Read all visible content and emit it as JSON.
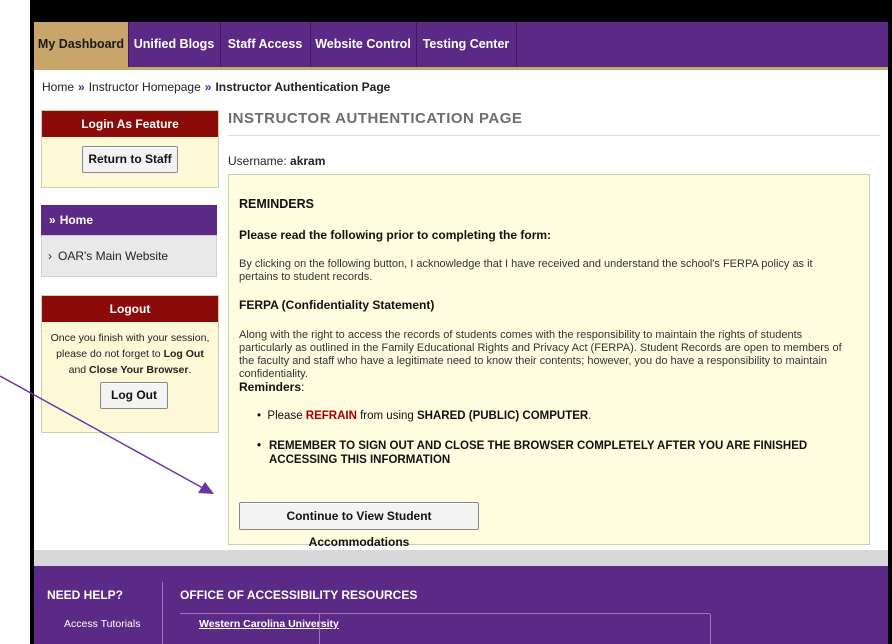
{
  "nav": {
    "tabs": [
      "My Dashboard",
      "Unified Blogs",
      "Staff Access",
      "Website Control",
      "Testing Center"
    ],
    "active_tab": "My Dashboard"
  },
  "breadcrumb": {
    "home": "Home",
    "separator": "»",
    "instructor": "Instructor Homepage",
    "current": "Instructor Authentication Page"
  },
  "sidebar": {
    "login_feature": {
      "title": "Login As Feature",
      "button": "Return to Staff"
    },
    "home_label": "Home",
    "home_icon": "chevron-double-down-icon",
    "links": [
      {
        "label": "OAR's Main Website",
        "icon": "chevron-right-icon"
      }
    ],
    "logout": {
      "title": "Logout",
      "text_1": "Once you finish with your session,",
      "text_2a": "please do not forget to ",
      "text_2b": "Log Out",
      "text_3a": "and ",
      "text_3b": "Close Your Browser",
      "text_3c": ".",
      "button": "Log Out"
    }
  },
  "main": {
    "title": "INSTRUCTOR AUTHENTICATION PAGE",
    "username_label": "Username: ",
    "username_value": "akram",
    "reminders": {
      "heading": "REMINDERS",
      "read_prompt": "Please read the following prior to completing the form:",
      "acknowledge": "By clicking on the following button, I acknowledge that I have received and understand the school's FERPA policy as it pertains to student records.",
      "ferpa_heading": "FERPA (Confidentiality Statement)",
      "ferpa_text": "Along with the right to access the records of students comes with the responsibility to maintain the rights of students particularly as outlined in the Family Educational Rights and Privacy Act (FERPA). Student Records are open to members of the faculty and staff who have a legitimate need to know their contents; however, you do have a responsibility to maintain confidentiality.",
      "reminders_label": "Reminders",
      "reminders_colon": ":",
      "bullet_1a": "Please ",
      "bullet_1b": "REFRAIN",
      "bullet_1c": " from using ",
      "bullet_1d": "SHARED (PUBLIC) COMPUTER",
      "bullet_1e": ".",
      "bullet_2": "REMEMBER TO SIGN OUT AND CLOSE THE BROWSER COMPLETELY AFTER YOU ARE FINISHED ACCESSING THIS INFORMATION",
      "continue_button": "Continue to View Student Accommodations"
    }
  },
  "footer": {
    "need_help": "NEED HELP?",
    "office": "OFFICE OF ACCESSIBILITY RESOURCES",
    "access_tutorials": "Access Tutorials",
    "wcu": "Western Carolina University"
  },
  "colors": {
    "purple": "#5b2a86",
    "gold": "#c8a56a",
    "dark_red": "#8b0a0a",
    "cream": "#fffde0",
    "arrow": "#6a35a8"
  }
}
